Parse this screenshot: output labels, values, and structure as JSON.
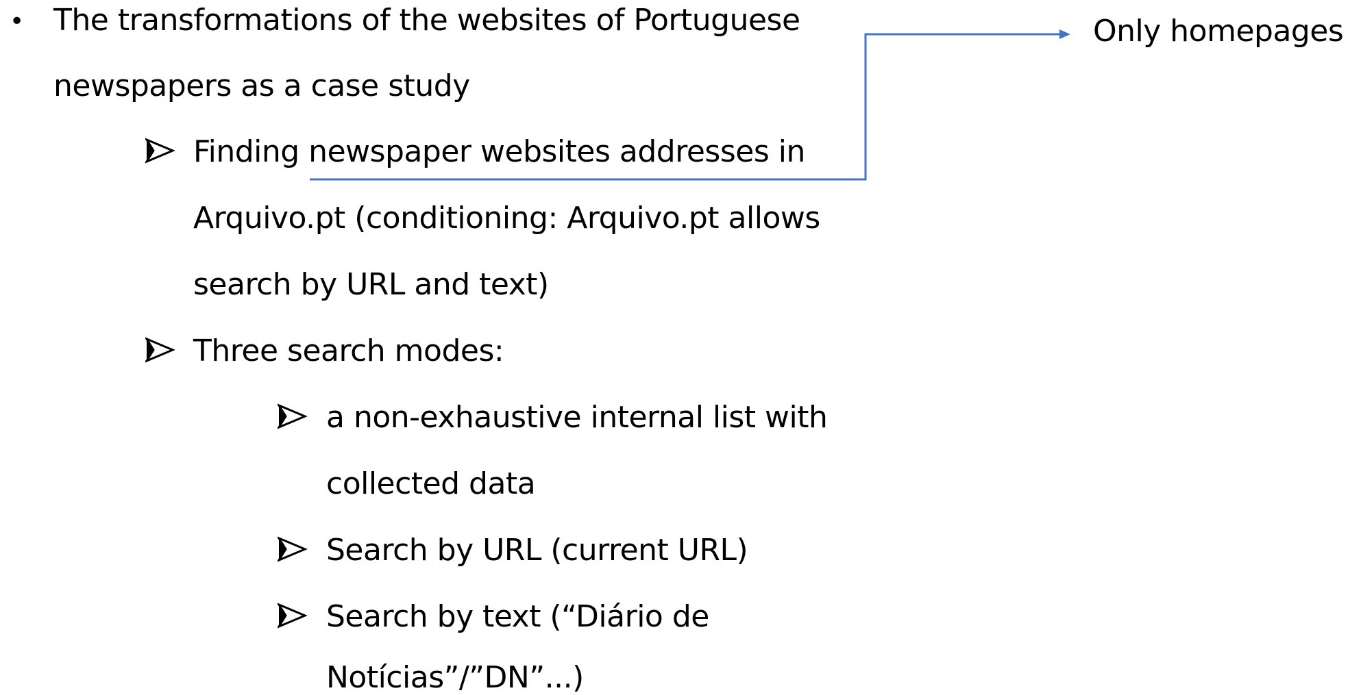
{
  "colors": {
    "text": "#000000",
    "connector": "#4472C4"
  },
  "icons": {
    "main_bullet": "round-bullet",
    "sub_bullet": "arrowhead-bullet",
    "connector": "elbow-arrow-connector"
  },
  "main_bullet": {
    "lines": [
      "The transformations of the websites of Portuguese",
      "newspapers as a case study"
    ]
  },
  "sub_items": [
    {
      "lines": [
        "Finding newspaper websites addresses in",
        "Arquivo.pt (conditioning: Arquivo.pt allows",
        "search by URL and text)"
      ]
    },
    {
      "lines": [
        "Three search modes:"
      ]
    }
  ],
  "search_modes": [
    {
      "lines": [
        "a non-exhaustive internal list with",
        "collected data"
      ]
    },
    {
      "lines": [
        "Search by URL (current URL)"
      ]
    },
    {
      "lines": [
        "Search by text (“Diário de",
        "Notícias”/”DN”...)"
      ]
    }
  ],
  "callout": {
    "label": "Only homepages"
  }
}
